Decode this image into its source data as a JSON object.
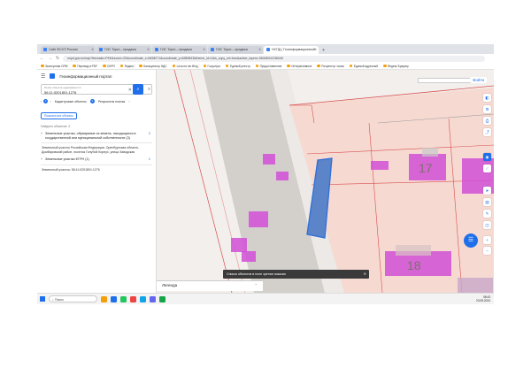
{
  "browser": {
    "tabs": [
      {
        "title": "Сайт ФССП России",
        "active": false
      },
      {
        "title": "ГИС Торги – продажа",
        "active": false
      },
      {
        "title": "ГИС Торги – продажа",
        "active": false
      },
      {
        "title": "ГИС Торги – продажа",
        "active": false
      },
      {
        "title": "НСПД | Геоинформационный",
        "active": true
      }
    ],
    "url": "nspd.gov.ru/map?thematic=PKK&zoom=20&coordinate_x=6498271&coordinate_y=6989843&theme_id=1&is_copy_url=true&active_layers=36048%2C36049",
    "bookmarks": [
      "Экспортная ОРМ",
      "Перевод в PDF",
      "СКРЯ",
      "Яндекс",
      "Калькулятор НДС",
      "Lexa на Inn Bing",
      "Госуслуги",
      "Единый реестр",
      "Предоставление",
      "Интерактивные",
      "Росреестр: поиск",
      "Единый адресный",
      "Яндекс Браузер"
    ]
  },
  "panel": {
    "title": "Геоинформационный портал",
    "search_label": "Поиск объекта недвижимости",
    "search_value": "56:11:0201801:1276",
    "tabs": [
      {
        "label": "Кадастровые объекты",
        "count": "1"
      },
      {
        "label": "Результаты поиска",
        "count": ""
      }
    ],
    "show_all": "Показать все объекты",
    "found": "Найдено объектов: 3",
    "groups": [
      {
        "heading": "Земельные участки, образуемые из земель, находящихся в государственной или муниципальной собственности (3)",
        "count": "2",
        "item": "Земельный участок Российская Федерация, Оренбургская область, Домбаровский район, поселок Голубой Корпус, улица Заводская"
      },
      {
        "heading": "Земельные участки ЕГРН (1)",
        "count": "1",
        "item": "Земельный участок: 56:11:0201801:1276"
      }
    ]
  },
  "map": {
    "login": "Войти",
    "legend": "Легенда",
    "toast": "Список объектов в поле зрения показан",
    "building_labels": [
      "17",
      "18"
    ],
    "colors": {
      "parcel_fill": "#f6dad2",
      "parcel_line": "#d94f4f",
      "building": "#d14fd6",
      "selected": "#2f6fd8",
      "road": "#d2cfcb"
    }
  },
  "taskbar": {
    "search": "Поиск",
    "time": "08:43",
    "date": "23.05.2024"
  }
}
